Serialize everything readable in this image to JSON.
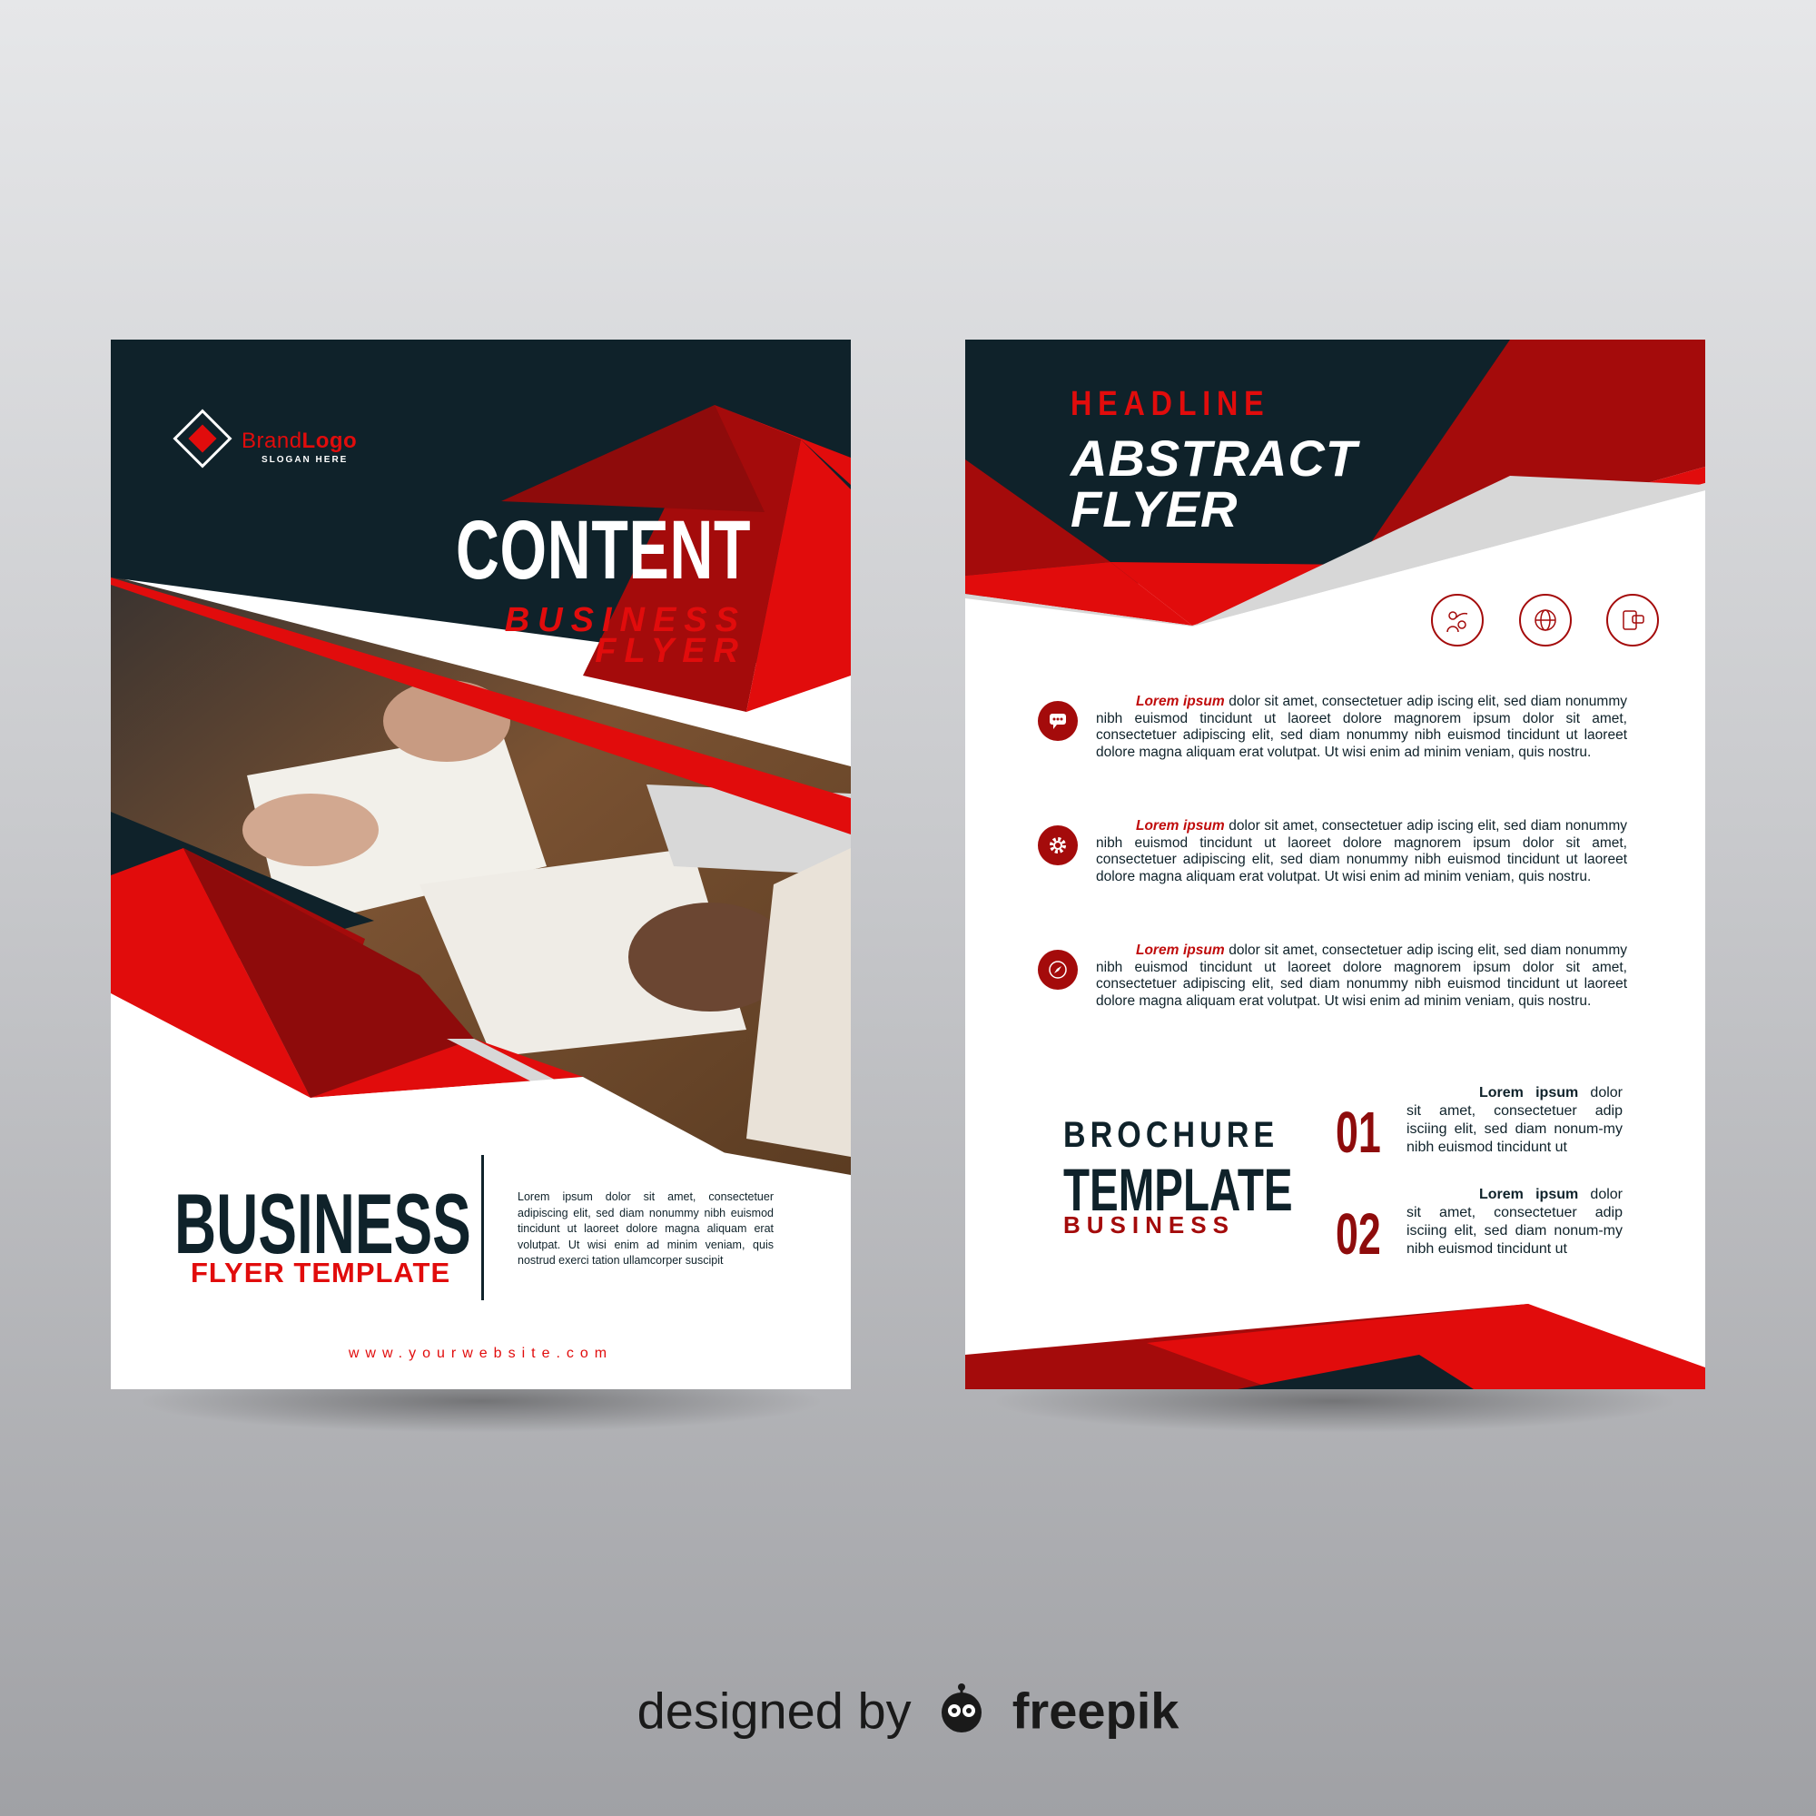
{
  "left_page": {
    "brand_name_part1": "Brand",
    "brand_name_part2": "Logo",
    "brand_slogan": "SLOGAN HERE",
    "title": "CONTENT",
    "subtitle_line1": "BUSINESS",
    "subtitle_line2": "FLYER",
    "bottom_title": "BUSINESS",
    "bottom_subtitle": "FLYER TEMPLATE",
    "body_text": "Lorem ipsum dolor sit amet, consectetuer adipiscing elit, sed diam nonummy nibh euismod tincidunt ut laoreet dolore magna aliquam erat volutpat. Ut wisi enim ad minim veniam, quis nostrud exerci tation ullamcorper suscipit",
    "website": "www.yourwebsite.com"
  },
  "right_page": {
    "headline": "HEADLINE",
    "title_line1": "ABSTRACT",
    "title_line2": "FLYER",
    "paragraphs": [
      {
        "lead": "Lorem ipsum",
        "text": " dolor sit amet, consectetuer adip iscing elit, sed diam nonummy nibh euismod tincidunt ut laoreet dolore magnorem ipsum dolor sit amet, consectetuer adipiscing elit, sed diam nonummy nibh euismod tincidunt ut laoreet dolore magna aliquam erat volutpat. Ut wisi enim ad minim veniam, quis nostru."
      },
      {
        "lead": "Lorem ipsum",
        "text": " dolor sit amet, consectetuer adip iscing elit, sed diam nonummy nibh euismod tincidunt ut laoreet dolore magnorem ipsum dolor sit amet, consectetuer adipiscing elit, sed diam nonummy nibh euismod tincidunt ut laoreet dolore magna aliquam erat volutpat. Ut wisi enim ad minim veniam, quis nostru."
      },
      {
        "lead": "Lorem ipsum",
        "text": " dolor sit amet, consectetuer adip iscing elit, sed diam nonummy nibh euismod tincidunt ut laoreet dolore magnorem ipsum dolor sit amet, consectetuer adipiscing elit, sed diam nonummy nibh euismod tincidunt ut laoreet dolore magna aliquam erat volutpat. Ut wisi enim ad minim veniam, quis nostru."
      }
    ],
    "brochure_line1": "BROCHURE",
    "brochure_line2": "TEMPLATE",
    "brochure_line3": "BUSINESS",
    "numbered": [
      {
        "number": "01",
        "lead": "Lorem ipsum",
        "text": " dolor sit amet, consectetuer adip isciing elit, sed diam nonum-my nibh euismod tincidunt ut"
      },
      {
        "number": "02",
        "lead": "Lorem ipsum",
        "text": " dolor sit amet, consectetuer adip isciing elit, sed diam nonum-my nibh euismod tincidunt ut"
      }
    ],
    "icons": [
      "people-network-icon",
      "globe-icon",
      "chat-devices-icon"
    ],
    "bullet_icons": [
      "chat-bubble-icon",
      "gear-icon",
      "compass-icon"
    ]
  },
  "credit": {
    "prefix": "designed by",
    "brand": "freepik"
  },
  "colors": {
    "dark_navy": "#0f222a",
    "red": "#e10c0c",
    "dark_red": "#a40b0b"
  }
}
